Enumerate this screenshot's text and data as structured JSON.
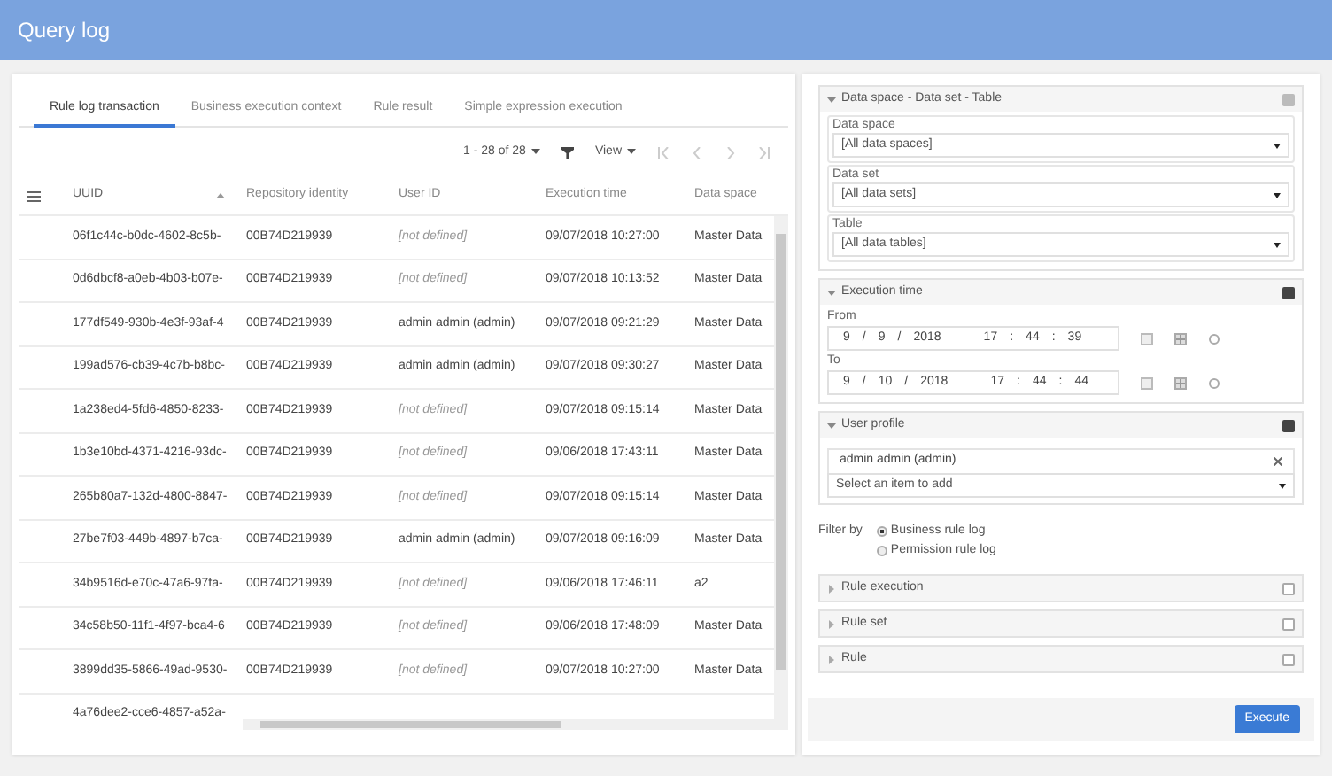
{
  "header": {
    "title": "Query log"
  },
  "tabs": [
    {
      "label": "Rule log transaction",
      "selected": true
    },
    {
      "label": "Business execution context",
      "selected": false
    },
    {
      "label": "Rule result",
      "selected": false
    },
    {
      "label": "Simple expression execution",
      "selected": false
    }
  ],
  "pager": {
    "range": "1 - 28 of 28",
    "view": "View"
  },
  "table": {
    "columns": [
      {
        "label": "UUID",
        "sorted": true
      },
      {
        "label": "Repository identity",
        "sorted": false
      },
      {
        "label": "User ID",
        "sorted": false
      },
      {
        "label": "Execution time",
        "sorted": false
      },
      {
        "label": "Data space",
        "sorted": false
      }
    ],
    "rows": [
      {
        "cells": [
          "06f1c44c-b0dc-4602-8c5b-",
          "00B74D219939",
          "[not defined]",
          "09/07/2018 10:27:00",
          "Master Data"
        ],
        "user_missing": true
      },
      {
        "cells": [
          "0d6dbcf8-a0eb-4b03-b07e-",
          "00B74D219939",
          "[not defined]",
          "09/07/2018 10:13:52",
          "Master Data"
        ],
        "user_missing": true
      },
      {
        "cells": [
          "177df549-930b-4e3f-93af-4",
          "00B74D219939",
          "admin admin (admin)",
          "09/07/2018 09:21:29",
          "Master Data"
        ],
        "user_missing": false
      },
      {
        "cells": [
          "199ad576-cb39-4c7b-b8bc-",
          "00B74D219939",
          "admin admin (admin)",
          "09/07/2018 09:30:27",
          "Master Data"
        ],
        "user_missing": false
      },
      {
        "cells": [
          "1a238ed4-5fd6-4850-8233-",
          "00B74D219939",
          "[not defined]",
          "09/07/2018 09:15:14",
          "Master Data"
        ],
        "user_missing": true
      },
      {
        "cells": [
          "1b3e10bd-4371-4216-93dc-",
          "00B74D219939",
          "[not defined]",
          "09/06/2018 17:43:11",
          "Master Data"
        ],
        "user_missing": true
      },
      {
        "cells": [
          "265b80a7-132d-4800-8847-",
          "00B74D219939",
          "[not defined]",
          "09/07/2018 09:15:14",
          "Master Data"
        ],
        "user_missing": true
      },
      {
        "cells": [
          "27be7f03-449b-4897-b7ca-",
          "00B74D219939",
          "admin admin (admin)",
          "09/07/2018 09:16:09",
          "Master Data"
        ],
        "user_missing": false
      },
      {
        "cells": [
          "34b9516d-e70c-47a6-97fa-",
          "00B74D219939",
          "[not defined]",
          "09/06/2018 17:46:11",
          "a2"
        ],
        "user_missing": true
      },
      {
        "cells": [
          "34c58b50-11f1-4f97-bca4-6",
          "00B74D219939",
          "[not defined]",
          "09/06/2018 17:48:09",
          "Master Data"
        ],
        "user_missing": true
      },
      {
        "cells": [
          "3899dd35-5866-49ad-9530-",
          "00B74D219939",
          "[not defined]",
          "09/07/2018 10:27:00",
          "Master Data"
        ],
        "user_missing": true
      },
      {
        "cells": [
          "4a76dee2-cce6-4857-a52a-"
        ]
      }
    ]
  },
  "filters": [
    {
      "kind": "selects",
      "title": "Data space - Data set - Table",
      "expanded": true,
      "checked": true,
      "disabled": true,
      "fields": [
        {
          "label": "Data space",
          "value": "[All data spaces]"
        },
        {
          "label": "Data set",
          "value": "[All data sets]"
        },
        {
          "label": "Table",
          "value": "[All data tables]"
        }
      ]
    },
    {
      "kind": "datetime",
      "title": "Execution time",
      "expanded": true,
      "checked": true,
      "disabled": false,
      "date_separator": "/",
      "time_separator": ":",
      "ranges": [
        {
          "label": "From",
          "date": [
            "9",
            "9",
            "2018"
          ],
          "time": [
            "17",
            "44",
            "39"
          ]
        },
        {
          "label": "To",
          "date": [
            "9",
            "10",
            "2018"
          ],
          "time": [
            "17",
            "44",
            "44"
          ]
        }
      ]
    },
    {
      "kind": "profile",
      "title": "User profile",
      "expanded": true,
      "checked": true,
      "disabled": false,
      "tags": [
        "admin admin (admin)"
      ],
      "placeholder": "Select an item to add"
    },
    {
      "kind": "radio",
      "label": "Filter by",
      "options": [
        {
          "label": "Business rule log",
          "selected": true
        },
        {
          "label": "Permission rule log",
          "selected": false
        }
      ]
    },
    {
      "kind": "panel",
      "title": "Rule execution",
      "expanded": false,
      "checked": false,
      "disabled": false
    },
    {
      "kind": "panel",
      "title": "Rule set",
      "expanded": false,
      "checked": false,
      "disabled": false
    },
    {
      "kind": "panel",
      "title": "Rule",
      "expanded": false,
      "checked": false,
      "disabled": false
    }
  ],
  "execute_button": "Execute"
}
